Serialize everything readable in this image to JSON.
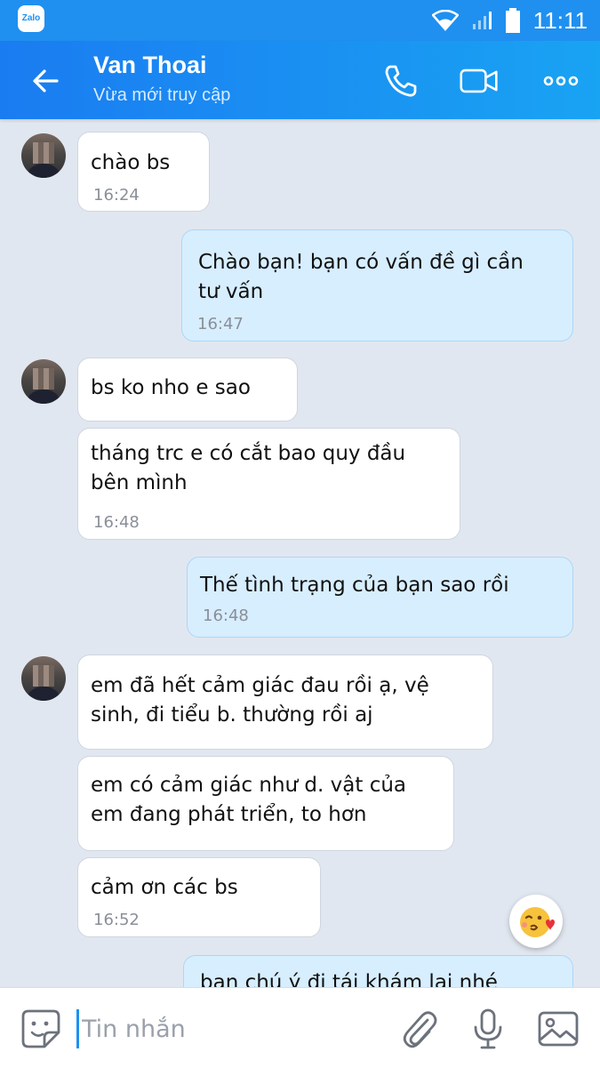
{
  "status_bar": {
    "app_badge": "Zalo",
    "time": "11:11"
  },
  "header": {
    "title": "Van Thoai",
    "subtitle": "Vừa mới truy cập"
  },
  "messages": [
    {
      "text": "chào bs",
      "time": "16:24"
    },
    {
      "text": "Chào bạn! bạn có vấn đề gì cần\ntư vấn",
      "time": "16:47"
    },
    {
      "text": "bs ko nho e sao",
      "time": ""
    },
    {
      "text": "tháng trc e có cắt bao quy đầu\nbên mình",
      "time": "16:48"
    },
    {
      "text": "Thế tình trạng của bạn sao rồi",
      "time": "16:48"
    },
    {
      "text": "em đã hết cảm giác đau rồi ạ, vệ\nsinh, đi tiểu b. thường rồi aj",
      "time": ""
    },
    {
      "text": "em có cảm giác như d. vật của\nem đang phát triển, to hơn",
      "time": ""
    },
    {
      "text": "cảm ơn các bs",
      "time": "16:52"
    },
    {
      "text": "bạn chú ý đi tái khám lại nhé",
      "time": ""
    }
  ],
  "composer": {
    "placeholder": "Tin nhắn",
    "value": ""
  },
  "colors": {
    "accent": "#1f90f0",
    "incoming_bubble": "#ffffff",
    "outgoing_bubble": "#d7eeff",
    "chat_bg": "#e1e7f0"
  },
  "icons": [
    "back-arrow-icon",
    "phone-icon",
    "video-call-icon",
    "more-icon",
    "sticker-icon",
    "attach-icon",
    "microphone-icon",
    "image-icon",
    "kiss-emoji-icon"
  ]
}
